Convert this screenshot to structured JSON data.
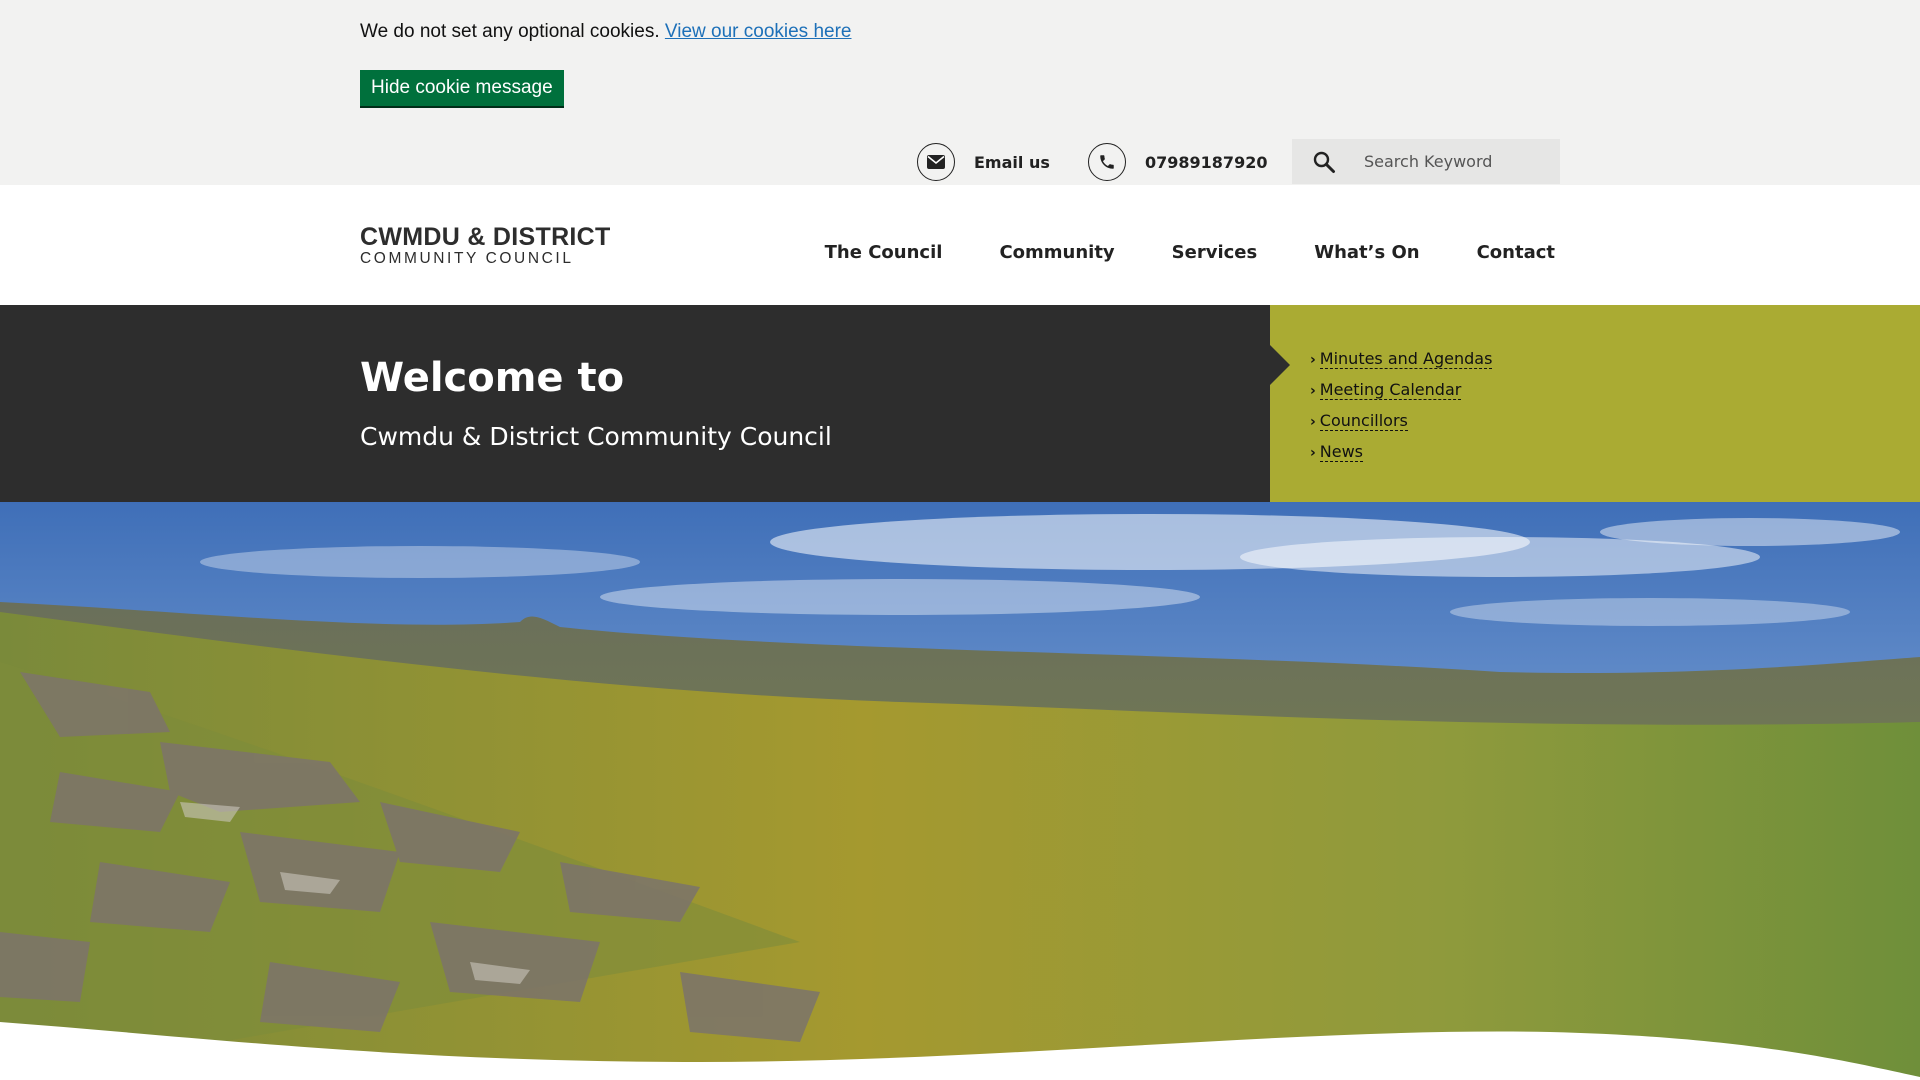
{
  "cookie": {
    "message": "We do not set any optional cookies. ",
    "link": "View our cookies here",
    "hide_button": "Hide cookie message"
  },
  "utility": {
    "email_icon": "envelope-icon",
    "email_label": "Email us",
    "phone_icon": "phone-icon",
    "phone_number": "07989187920",
    "search_icon": "search-icon",
    "search_placeholder": "Search Keyword"
  },
  "logo": {
    "line1": "CWMDU & DISTRICT",
    "line2": "COMMUNITY COUNCIL"
  },
  "nav": {
    "items": [
      "The Council",
      "Community",
      "Services",
      "What’s On",
      "Contact"
    ]
  },
  "welcome": {
    "title": "Welcome to",
    "subtitle": "Cwmdu & District Community Council"
  },
  "quick_links": {
    "items": [
      "Minutes and Agendas",
      "Meeting Calendar",
      "Councillors",
      "News"
    ]
  },
  "colors": {
    "accent_green": "#00703c",
    "olive": "#aaab33",
    "dark": "#2d2d2d",
    "link_blue": "#1d70b8"
  }
}
